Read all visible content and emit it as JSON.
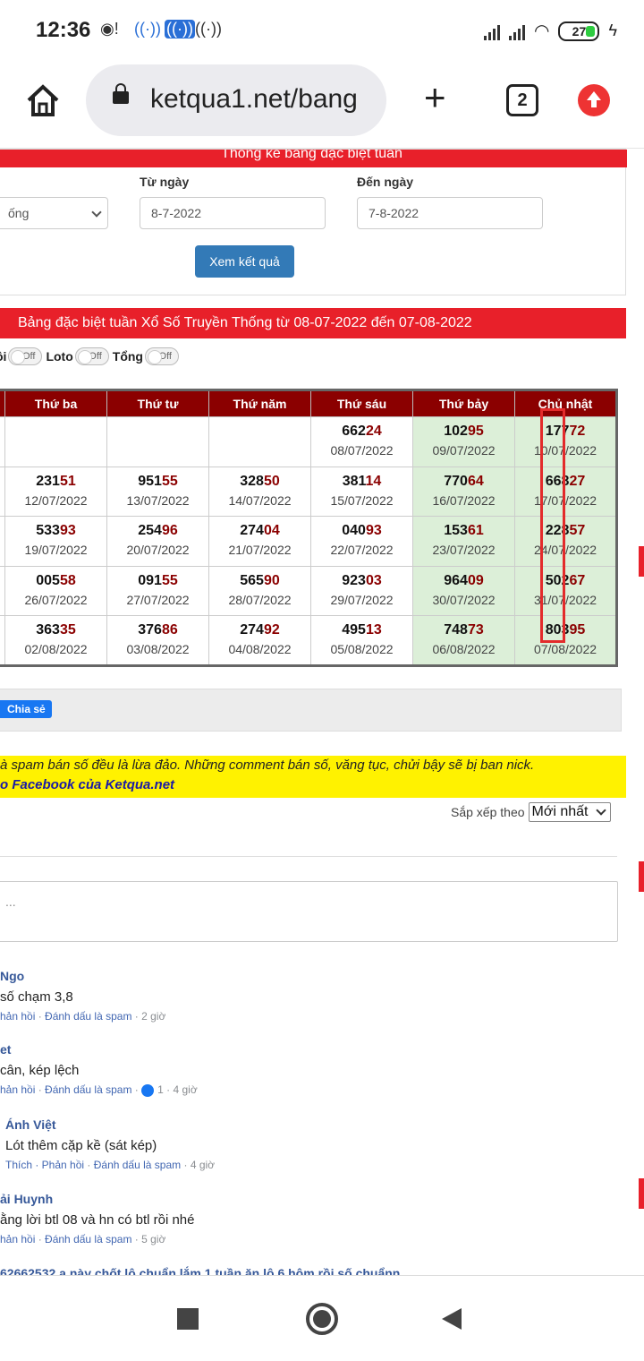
{
  "status": {
    "time": "12:36",
    "battery": "27"
  },
  "browser": {
    "url": "ketqua1.net/bang",
    "tab_count": "2"
  },
  "form": {
    "banner": "Thống kê bảng đặc biệt tuần",
    "select_value": "ống",
    "from_label": "Từ ngày",
    "from_value": "8-7-2022",
    "to_label": "Đến ngày",
    "to_value": "7-8-2022",
    "submit": "Xem kết quả"
  },
  "table_title": "Bảng đặc biệt tuần Xổ Số Truyền Thống từ 08-07-2022 đến 07-08-2022",
  "toggles": [
    {
      "label": "ôi",
      "state": "Off"
    },
    {
      "label": "Loto",
      "state": "Off"
    },
    {
      "label": "Tổng",
      "state": "Off"
    }
  ],
  "headers": [
    "Thứ ba",
    "Thứ tư",
    "Thứ năm",
    "Thứ sáu",
    "Thứ bảy",
    "Chủ nhật"
  ],
  "rows": [
    [
      null,
      null,
      null,
      {
        "h": "662",
        "t": "24",
        "d": "08/07/2022"
      },
      {
        "h": "102",
        "t": "95",
        "d": "09/07/2022"
      },
      {
        "h": "177",
        "t": "72",
        "d": "10/07/2022"
      }
    ],
    [
      {
        "h": "231",
        "t": "51",
        "d": "12/07/2022"
      },
      {
        "h": "951",
        "t": "55",
        "d": "13/07/2022"
      },
      {
        "h": "328",
        "t": "50",
        "d": "14/07/2022"
      },
      {
        "h": "381",
        "t": "14",
        "d": "15/07/2022"
      },
      {
        "h": "770",
        "t": "64",
        "d": "16/07/2022"
      },
      {
        "h": "668",
        "t": "27",
        "d": "17/07/2022"
      }
    ],
    [
      {
        "h": "533",
        "t": "93",
        "d": "19/07/2022"
      },
      {
        "h": "254",
        "t": "96",
        "d": "20/07/2022"
      },
      {
        "h": "274",
        "t": "04",
        "d": "21/07/2022"
      },
      {
        "h": "040",
        "t": "93",
        "d": "22/07/2022"
      },
      {
        "h": "153",
        "t": "61",
        "d": "23/07/2022"
      },
      {
        "h": "228",
        "t": "57",
        "d": "24/07/2022"
      }
    ],
    [
      {
        "h": "005",
        "t": "58",
        "d": "26/07/2022"
      },
      {
        "h": "091",
        "t": "55",
        "d": "27/07/2022"
      },
      {
        "h": "565",
        "t": "90",
        "d": "28/07/2022"
      },
      {
        "h": "923",
        "t": "03",
        "d": "29/07/2022"
      },
      {
        "h": "964",
        "t": "09",
        "d": "30/07/2022"
      },
      {
        "h": "502",
        "t": "67",
        "d": "31/07/2022"
      }
    ],
    [
      {
        "h": "363",
        "t": "35",
        "d": "02/08/2022"
      },
      {
        "h": "376",
        "t": "86",
        "d": "03/08/2022"
      },
      {
        "h": "274",
        "t": "92",
        "d": "04/08/2022"
      },
      {
        "h": "495",
        "t": "13",
        "d": "05/08/2022"
      },
      {
        "h": "748",
        "t": "73",
        "d": "06/08/2022"
      },
      {
        "h": "803",
        "t": "95",
        "d": "07/08/2022"
      }
    ]
  ],
  "share": "Chia sẻ",
  "notice": {
    "line1": "à spam bán số đều là lừa đảo. Những comment bán số, văng tục, chửi bậy sẽ bị ban nick.",
    "line2": "o Facebook của Ketqua.net"
  },
  "sort": {
    "label": "Sắp xếp theo",
    "value": "Mới nhất"
  },
  "comment_placeholder": "...",
  "comments": [
    {
      "name": "Ngo",
      "text": "số chạm 3,8",
      "reply": "hản hồi",
      "spam": "Đánh dấu là spam",
      "likes": "",
      "time": "2 giờ"
    },
    {
      "name": "et",
      "text": "cân, kép lệch",
      "reply": "hản hồi",
      "spam": "Đánh dấu là spam",
      "likes": "1",
      "time": "4 giờ"
    },
    {
      "name": "Ánh Việt",
      "text": "Lót thêm cặp kề (sát kép)",
      "reply": "Thích · Phản hồi",
      "spam": "Đánh dấu là spam",
      "likes": "",
      "time": "4 giờ"
    },
    {
      "name": "ải Huynh",
      "text": "ằng lời btl 08 và hn có btl rồi nhé",
      "reply": "hản hồi",
      "spam": "Đánh dấu là spam",
      "likes": "",
      "time": "5 giờ"
    },
    {
      "name": "62662532 a này chốt lô chuẩn lắm 1 tuần ăn lô 6 hôm rồi số chuẩnn",
      "text": "",
      "reply": "",
      "spam": "",
      "likes": "",
      "time": ""
    }
  ]
}
